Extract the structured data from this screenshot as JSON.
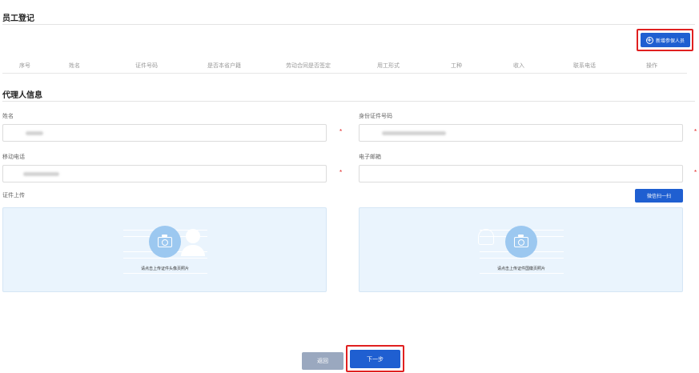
{
  "employee_section": {
    "title": "员工登记",
    "add_button_label": "新增参保人员",
    "table_columns": [
      "序号",
      "姓名",
      "证件号码",
      "是否本省户籍",
      "劳动合同是否签定",
      "用工形式",
      "工种",
      "收入",
      "联系电话",
      "操作"
    ]
  },
  "agent_section": {
    "title": "代理人信息",
    "fields": {
      "name": {
        "label": "姓名",
        "required_mark": "*"
      },
      "id_number": {
        "label": "身份证件号码",
        "required_mark": "*"
      },
      "mobile": {
        "label": "移动电话",
        "required_mark": "*"
      },
      "email": {
        "label": "电子邮箱",
        "required_mark": "*"
      }
    },
    "upload_label": "证件上传",
    "wechat_scan_label": "微信扫一扫",
    "upload_front_hint": "请点击上传证件头像页照片",
    "upload_back_hint": "请点击上传证件国徽页照片"
  },
  "footer": {
    "back_label": "返回",
    "next_label": "下一步"
  },
  "colors": {
    "primary": "#1f5fd1",
    "secondary_button": "#9aa8bf",
    "highlight": "#e02020",
    "upload_bg": "#eaf4fd"
  }
}
